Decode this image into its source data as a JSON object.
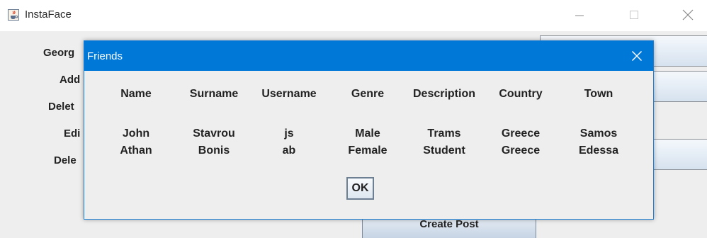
{
  "window": {
    "title": "InstaFace",
    "side_labels": [
      "Georg",
      "Add",
      "Delet",
      "Edi",
      "Dele"
    ],
    "create_post_label": "Create Post"
  },
  "dialog": {
    "title": "Friends",
    "columns": [
      "Name",
      "Surname",
      "Username",
      "Genre",
      "Description",
      "Country",
      "Town"
    ],
    "rows": [
      [
        "John",
        "Stavrou",
        "js",
        "Male",
        "Trams",
        "Greece",
        "Samos"
      ],
      [
        "Athan",
        "Bonis",
        "ab",
        "Female",
        "Student",
        "Greece",
        "Edessa"
      ]
    ],
    "ok_label": "OK"
  },
  "icons": {
    "app": "java-cup-icon",
    "minimize": "minimize-icon",
    "maximize": "maximize-icon",
    "close": "close-icon"
  },
  "colors": {
    "dialog_titlebar": "#0078d7",
    "window_background": "#eeeeee",
    "button_gradient_top": "#f4f8fc",
    "button_gradient_bottom": "#d6e2ef"
  }
}
